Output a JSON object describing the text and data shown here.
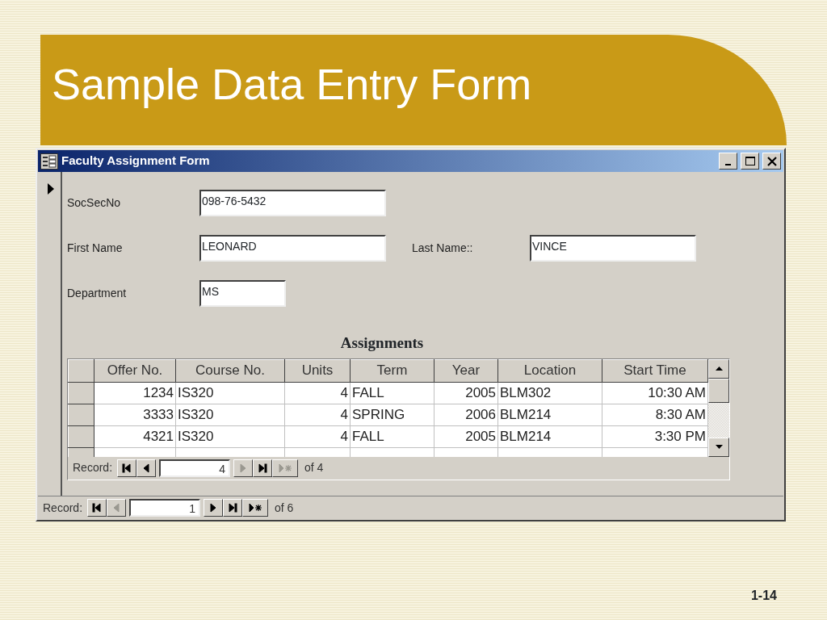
{
  "slide": {
    "title": "Sample Data Entry Form",
    "page_number": "1-14"
  },
  "window": {
    "title": "Faculty Assignment Form",
    "current_record": true
  },
  "field_rows": [
    [
      {
        "label": "SocSecNo",
        "value": "098-76-5432"
      }
    ],
    [
      {
        "label": "First Name",
        "value": "LEONARD"
      },
      {
        "label": "Last Name::",
        "value": "VINCE"
      }
    ],
    [
      {
        "label": "Department",
        "value": "MS"
      }
    ]
  ],
  "subform": {
    "title": "Assignments",
    "columns": [
      {
        "label": "Offer No.",
        "kind": "numeric"
      },
      {
        "label": "Course No.",
        "kind": "text"
      },
      {
        "label": "Units",
        "kind": "numeric"
      },
      {
        "label": "Term",
        "kind": "text"
      },
      {
        "label": "Year",
        "kind": "numeric"
      },
      {
        "label": "Location",
        "kind": "text"
      },
      {
        "label": "Start Time",
        "kind": "numeric"
      }
    ],
    "rows": [
      [
        "1234",
        "IS320",
        "4",
        "FALL",
        "2005",
        "BLM302",
        "10:30 AM"
      ],
      [
        "3333",
        "IS320",
        "4",
        "SPRING",
        "2006",
        "BLM214",
        "8:30 AM"
      ],
      [
        "4321",
        "IS320",
        "4",
        "FALL",
        "2005",
        "BLM214",
        "3:30 PM"
      ]
    ],
    "navigation": {
      "label": "Record:",
      "current": "4",
      "total": "of 4",
      "buttons": [
        {
          "kind": "first",
          "disabled": false
        },
        {
          "kind": "prev",
          "disabled": false
        },
        {
          "kind": "next",
          "disabled": true
        },
        {
          "kind": "last",
          "disabled": false
        },
        {
          "kind": "new",
          "disabled": true
        }
      ]
    }
  },
  "navigation": {
    "label": "Record:",
    "current": "1",
    "total": "of 6",
    "buttons": [
      {
        "kind": "first",
        "disabled": false
      },
      {
        "kind": "prev",
        "disabled": true
      },
      {
        "kind": "next",
        "disabled": false
      },
      {
        "kind": "last",
        "disabled": false
      },
      {
        "kind": "new",
        "disabled": false
      }
    ]
  }
}
